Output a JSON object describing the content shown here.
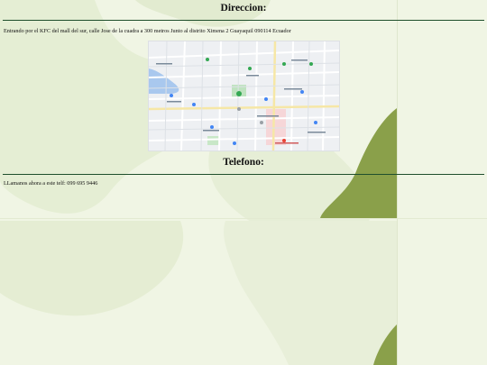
{
  "direccion": {
    "heading": "Direccion:",
    "address": "Entrando por el KFC del mall del sur, calle Jose de la cuadra a 300 metros Junto al distrito Ximena 2 Guayaquil 090114 Ecuador"
  },
  "telefono": {
    "heading": "Telefono:",
    "text": "LLamanos ahora a este telf: 099 695 9446"
  },
  "colors": {
    "page_background": "#f0f5e4",
    "blob_light": "#e4ecd2",
    "blob_dark": "#8aa04a",
    "rule": "#1f4f2c"
  }
}
